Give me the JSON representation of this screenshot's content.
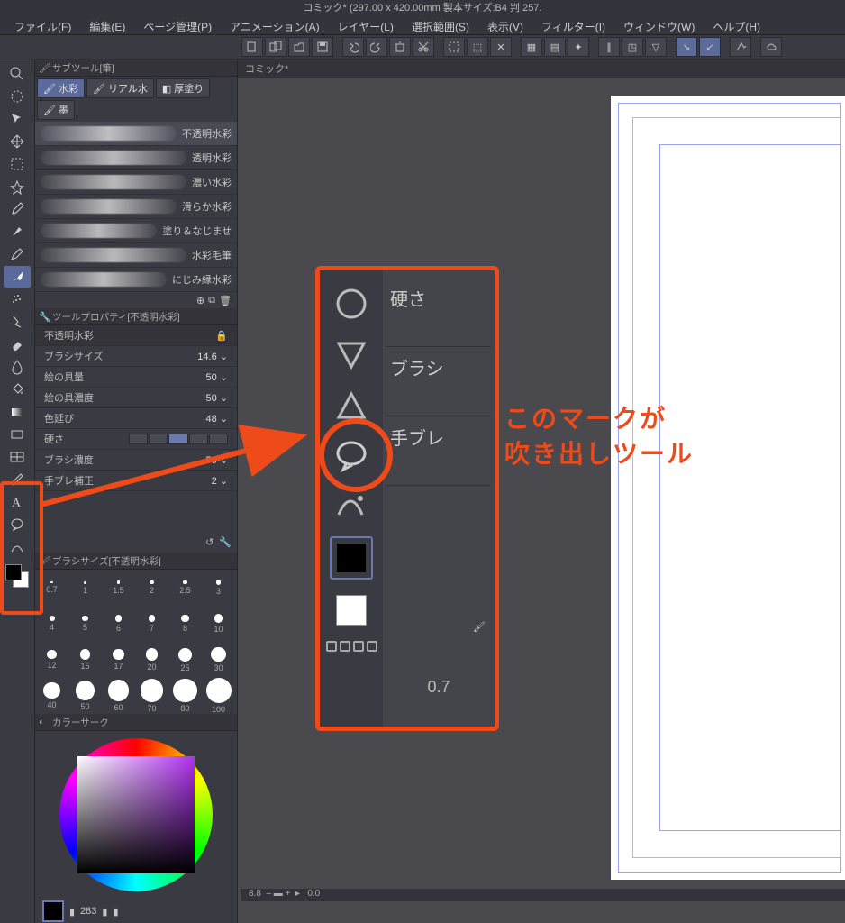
{
  "title": "コミック* (297.00 x 420.00mm 製本サイズ:B4 判 257.",
  "menu": [
    "ファイル(F)",
    "編集(E)",
    "ページ管理(P)",
    "アニメーション(A)",
    "レイヤー(L)",
    "選択範囲(S)",
    "表示(V)",
    "フィルター(I)",
    "ウィンドウ(W)",
    "ヘルプ(H)"
  ],
  "doc_tab": "コミック*",
  "subtool_panel_title": "サブツール[筆]",
  "brush_groups": [
    {
      "label": "水彩",
      "sel": true
    },
    {
      "label": "リアル水",
      "sel": false
    },
    {
      "label": "厚塗り",
      "sel": false
    },
    {
      "label": "墨",
      "sel": false
    }
  ],
  "brushes": [
    "不透明水彩",
    "透明水彩",
    "濃い水彩",
    "滑らか水彩",
    "塗り＆なじませ",
    "水彩毛筆",
    "にじみ縁水彩"
  ],
  "toolprop_panel_title": "ツールプロパティ[不透明水彩]",
  "currentbrush": "不透明水彩",
  "props": {
    "brush_size_label": "ブラシサイズ",
    "brush_size_val": "14.6",
    "paint_amount_label": "絵の具量",
    "paint_amount_val": "50",
    "paint_density_label": "絵の具濃度",
    "paint_density_val": "50",
    "color_extend_label": "色延び",
    "color_extend_val": "48",
    "hardness_label": "硬さ",
    "density_label": "ブラシ濃度",
    "density_val": "50",
    "stabilize_label": "手ブレ補正",
    "stabilize_val": "2"
  },
  "brushsize_panel_title": "ブラシサイズ[不透明水彩]",
  "size_presets": [
    0.7,
    1,
    1.5,
    2,
    2.5,
    3,
    4,
    5,
    6,
    7,
    8,
    10,
    12,
    15,
    17,
    20,
    25,
    30,
    40,
    50,
    60,
    70,
    80,
    100
  ],
  "colorcircle_panel_title": "カラーサーク",
  "hsv": {
    "h": "283",
    "s": "",
    "v": ""
  },
  "zoom_overlay": {
    "hardness": "硬さ",
    "brush": "ブラシ",
    "stabilize": "手ブレ",
    "bottom_val": "0.7"
  },
  "annotation": {
    "line1": "このマークが",
    "line2": "吹き出しツール"
  },
  "status": {
    "zoom": "8.8",
    "rot": "0.0"
  }
}
